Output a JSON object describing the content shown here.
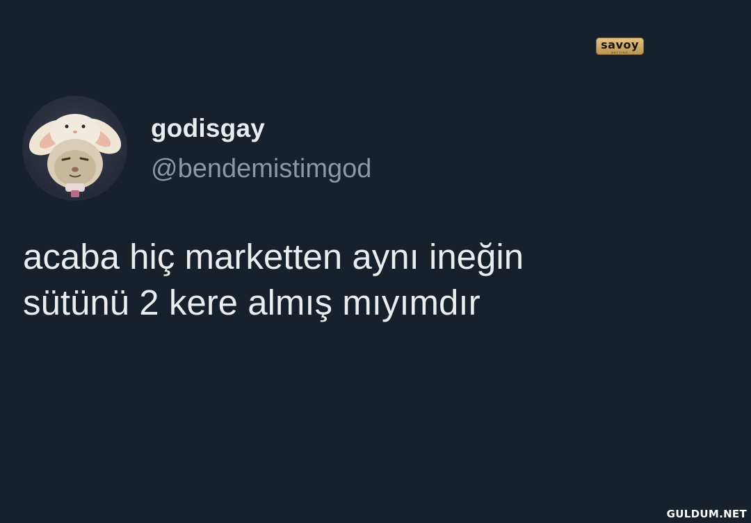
{
  "tweet": {
    "display_name": "godisgay",
    "handle": "@bendemistimgod",
    "text_lines": [
      "acaba hiç marketten aynı ineğin",
      "sütünü 2 kere almış mıyımdır"
    ],
    "avatar_icon": "white-bunny-hat-cat-avatar"
  },
  "sponsor": {
    "name": "savoy",
    "sub": "BETTING"
  },
  "watermark": {
    "text": "GULDUM.NET"
  },
  "colors": {
    "background": "#17202b",
    "name": "#e9ebee",
    "handle": "#8b98a5",
    "text": "#eaecee",
    "sponsor_gold": "#d6b171"
  }
}
